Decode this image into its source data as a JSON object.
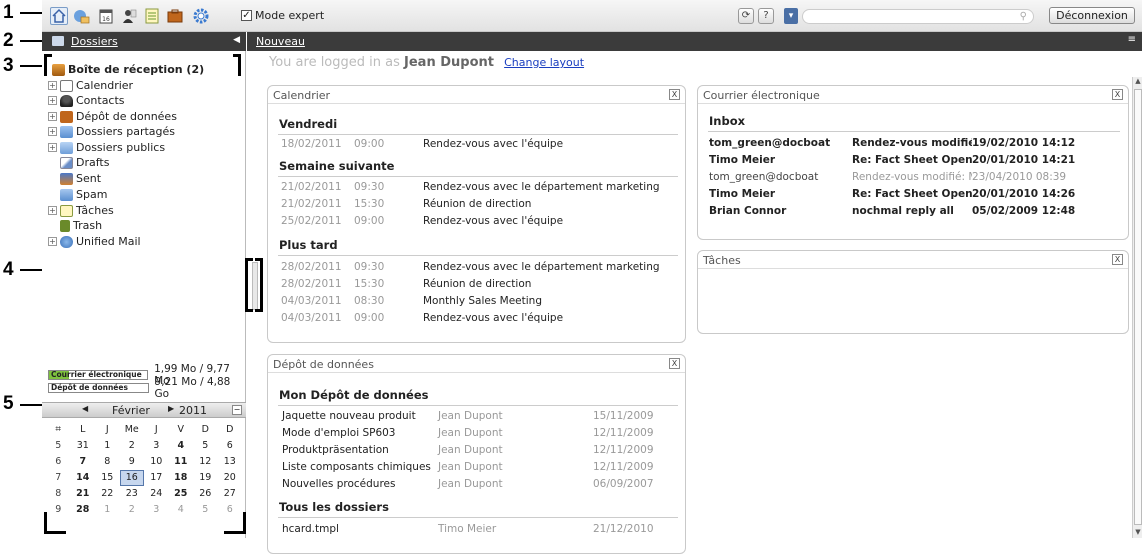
{
  "toolbar": {
    "mode_expert": "Mode expert",
    "logout": "Déconnexion",
    "icons": [
      "home-icon",
      "mail-icon",
      "calendar-icon",
      "contacts-icon",
      "tasks-icon",
      "infostore-icon",
      "settings-icon"
    ]
  },
  "sidebar": {
    "title": "Dossiers",
    "items": [
      {
        "label": "Boîte de réception (2)",
        "bold": true,
        "expandable": false
      },
      {
        "label": "Calendrier",
        "expandable": true
      },
      {
        "label": "Contacts",
        "expandable": true
      },
      {
        "label": "Dépôt de données",
        "expandable": true
      },
      {
        "label": "Dossiers partagés",
        "expandable": true
      },
      {
        "label": "Dossiers publics",
        "expandable": true
      },
      {
        "label": "Drafts",
        "expandable": false
      },
      {
        "label": "Sent",
        "expandable": false
      },
      {
        "label": "Spam",
        "expandable": false
      },
      {
        "label": "Tâches",
        "expandable": true
      },
      {
        "label": "Trash",
        "expandable": false
      },
      {
        "label": "Unified Mail",
        "expandable": true
      }
    ],
    "quota": [
      {
        "label": "Courrier électronique",
        "value": "1,99 Mo / 9,77 Mo",
        "fill": 0.2
      },
      {
        "label": "Dépôt de données",
        "value": "9,21 Mo / 4,88 Go",
        "fill": 0.0
      }
    ],
    "calendar": {
      "month": "Février",
      "year": "2011",
      "headers": [
        "L",
        "J",
        "Me",
        "J",
        "V",
        "D",
        "D"
      ],
      "weeks": [
        [
          "5",
          "31",
          "1",
          "2",
          "3",
          "4",
          "5",
          "6"
        ],
        [
          "6",
          "7",
          "8",
          "9",
          "10",
          "11",
          "12",
          "13"
        ],
        [
          "7",
          "14",
          "15",
          "16",
          "17",
          "18",
          "19",
          "20"
        ],
        [
          "8",
          "21",
          "22",
          "23",
          "24",
          "25",
          "26",
          "27"
        ],
        [
          "9",
          "28",
          "1",
          "2",
          "3",
          "4",
          "5",
          "6"
        ]
      ]
    }
  },
  "main": {
    "title": "Nouveau",
    "logged_prefix": "You are logged in as",
    "user": "Jean Dupont",
    "change_layout": "Change layout"
  },
  "calendar_widget": {
    "title": "Calendrier",
    "sections": [
      {
        "title": "Vendredi",
        "events": [
          {
            "date": "18/02/2011",
            "time": "09:00",
            "subject": "Rendez-vous avec l'équipe"
          }
        ]
      },
      {
        "title": "Semaine suivante",
        "events": [
          {
            "date": "21/02/2011",
            "time": "09:30",
            "subject": "Rendez-vous avec le département marketing"
          },
          {
            "date": "21/02/2011",
            "time": "15:30",
            "subject": "Réunion de direction"
          },
          {
            "date": "25/02/2011",
            "time": "09:00",
            "subject": "Rendez-vous avec l'équipe"
          }
        ]
      },
      {
        "title": "Plus tard",
        "events": [
          {
            "date": "28/02/2011",
            "time": "09:30",
            "subject": "Rendez-vous avec le département marketing"
          },
          {
            "date": "28/02/2011",
            "time": "15:30",
            "subject": "Réunion de direction"
          },
          {
            "date": "04/03/2011",
            "time": "08:30",
            "subject": "Monthly Sales Meeting"
          },
          {
            "date": "04/03/2011",
            "time": "09:00",
            "subject": "Rendez-vous avec l'équipe"
          }
        ]
      }
    ]
  },
  "mail_widget": {
    "title": "Courrier électronique",
    "section": "Inbox",
    "mails": [
      {
        "from": "tom_green@docboat",
        "subject": "Rendez-vous modifié: Month",
        "date": "19/02/2010 14:12",
        "bold": true
      },
      {
        "from": "Timo Meier",
        "subject": "Re: Fact Sheet Open-Xchange",
        "date": "20/01/2010 14:21",
        "bold": true
      },
      {
        "from": "tom_green@docboat",
        "subject": "Rendez-vous modifié: Month",
        "date": "23/04/2010 08:39",
        "bold": false
      },
      {
        "from": "Timo Meier",
        "subject": "Re: Fact Sheet Open-Xchange",
        "date": "20/01/2010 14:26",
        "bold": true
      },
      {
        "from": "Brian Connor",
        "subject": "nochmal reply all",
        "date": "05/02/2009 12:48",
        "bold": true
      }
    ]
  },
  "tasks_widget": {
    "title": "Tâches"
  },
  "infostore_widget": {
    "title": "Dépôt de données",
    "sections": [
      {
        "title": "Mon Dépôt de données",
        "files": [
          {
            "name": "Jaquette nouveau produit",
            "author": "Jean Dupont",
            "date": "15/11/2009"
          },
          {
            "name": "Mode d'emploi SP603",
            "author": "Jean Dupont",
            "date": "12/11/2009"
          },
          {
            "name": "Produktpräsentation",
            "author": "Jean Dupont",
            "date": "12/11/2009"
          },
          {
            "name": "Liste composants chimiques",
            "author": "Jean Dupont",
            "date": "12/11/2009"
          },
          {
            "name": "Nouvelles procédures",
            "author": "Jean Dupont",
            "date": "06/09/2007"
          }
        ]
      },
      {
        "title": "Tous les dossiers",
        "files": [
          {
            "name": "hcard.tmpl",
            "author": "Timo Meier",
            "date": "21/12/2010"
          }
        ]
      }
    ]
  },
  "close_label": "X",
  "annotations": [
    "1",
    "2",
    "3",
    "4",
    "5"
  ]
}
